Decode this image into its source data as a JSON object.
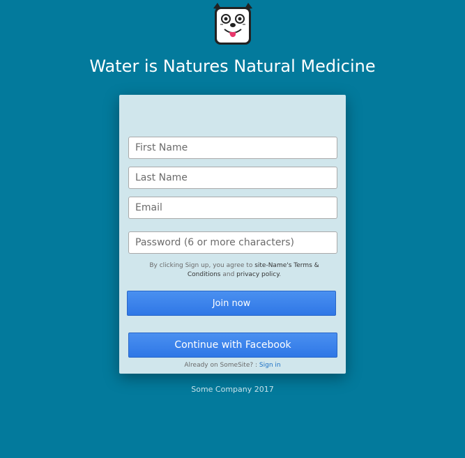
{
  "logo": {
    "icon": "dog-mascot-icon"
  },
  "header": {
    "title": "Water is Natures Natural Medicine"
  },
  "form": {
    "first_name_placeholder": "First Name",
    "last_name_placeholder": "Last Name",
    "email_placeholder": "Email",
    "password_placeholder": "Password (6 or more characters)",
    "terms_prefix": "By clicking Sign up, you agree to ",
    "terms_link": "site-Name's Terms & Conditions",
    "terms_and": " and ",
    "privacy_link": "privacy policy",
    "terms_suffix": ".",
    "join_label": "Join now",
    "facebook_label": "Continue with Facebook",
    "signin_prefix": "Already on SomeSite? : ",
    "signin_link": "Sign in"
  },
  "footer": {
    "text": "Some Company 2017"
  },
  "colors": {
    "background": "#037a9c",
    "card": "#d0e6ec",
    "button": "#3b82ec",
    "link": "#1a6fc4"
  }
}
